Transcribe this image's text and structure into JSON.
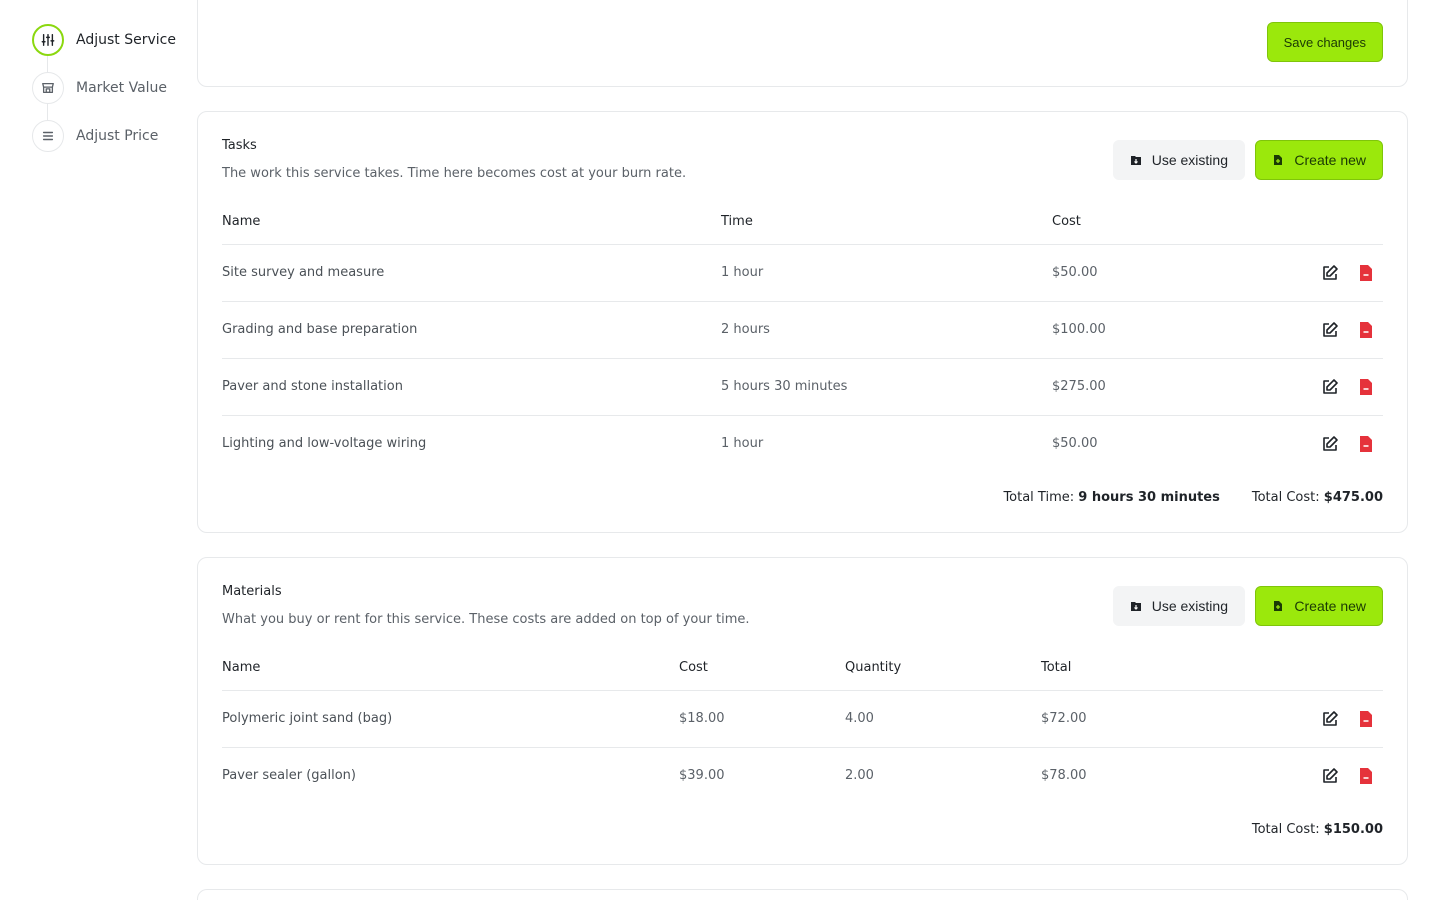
{
  "stepper": {
    "steps": [
      {
        "label": "Adjust Service",
        "icon": "sliders-icon",
        "active": true
      },
      {
        "label": "Market Value",
        "icon": "storefront-icon",
        "active": false
      },
      {
        "label": "Adjust Price",
        "icon": "stack-icon",
        "active": false
      }
    ]
  },
  "top_card": {
    "save_label": "Save changes"
  },
  "tasks": {
    "title": "Tasks",
    "description": "The work this service takes. Time here becomes cost at your burn rate.",
    "use_existing_label": "Use existing",
    "create_new_label": "Create new",
    "columns": [
      "Name",
      "Time",
      "Cost"
    ],
    "rows": [
      {
        "name": "Site survey and measure",
        "time": "1 hour",
        "cost": "$50.00"
      },
      {
        "name": "Grading and base preparation",
        "time": "2 hours",
        "cost": "$100.00"
      },
      {
        "name": "Paver and stone installation",
        "time": "5 hours 30 minutes",
        "cost": "$275.00"
      },
      {
        "name": "Lighting and low-voltage wiring",
        "time": "1 hour",
        "cost": "$50.00"
      }
    ],
    "total_time_label": "Total Time:",
    "total_time_value": "9 hours 30 minutes",
    "total_cost_label": "Total Cost:",
    "total_cost_value": "$475.00"
  },
  "materials": {
    "title": "Materials",
    "description": "What you buy or rent for this service. These costs are added on top of your time.",
    "use_existing_label": "Use existing",
    "create_new_label": "Create new",
    "columns": [
      "Name",
      "Cost",
      "Quantity",
      "Total"
    ],
    "rows": [
      {
        "name": "Polymeric joint sand (bag)",
        "cost": "$18.00",
        "quantity": "4.00",
        "total": "$72.00"
      },
      {
        "name": "Paver sealer (gallon)",
        "cost": "$39.00",
        "quantity": "2.00",
        "total": "$78.00"
      }
    ],
    "total_cost_label": "Total Cost:",
    "total_cost_value": "$150.00"
  },
  "colors": {
    "accent": "#9be80c",
    "accent_border": "#7fc50a",
    "delete": "#e5323b",
    "border": "#e7e9eb"
  }
}
